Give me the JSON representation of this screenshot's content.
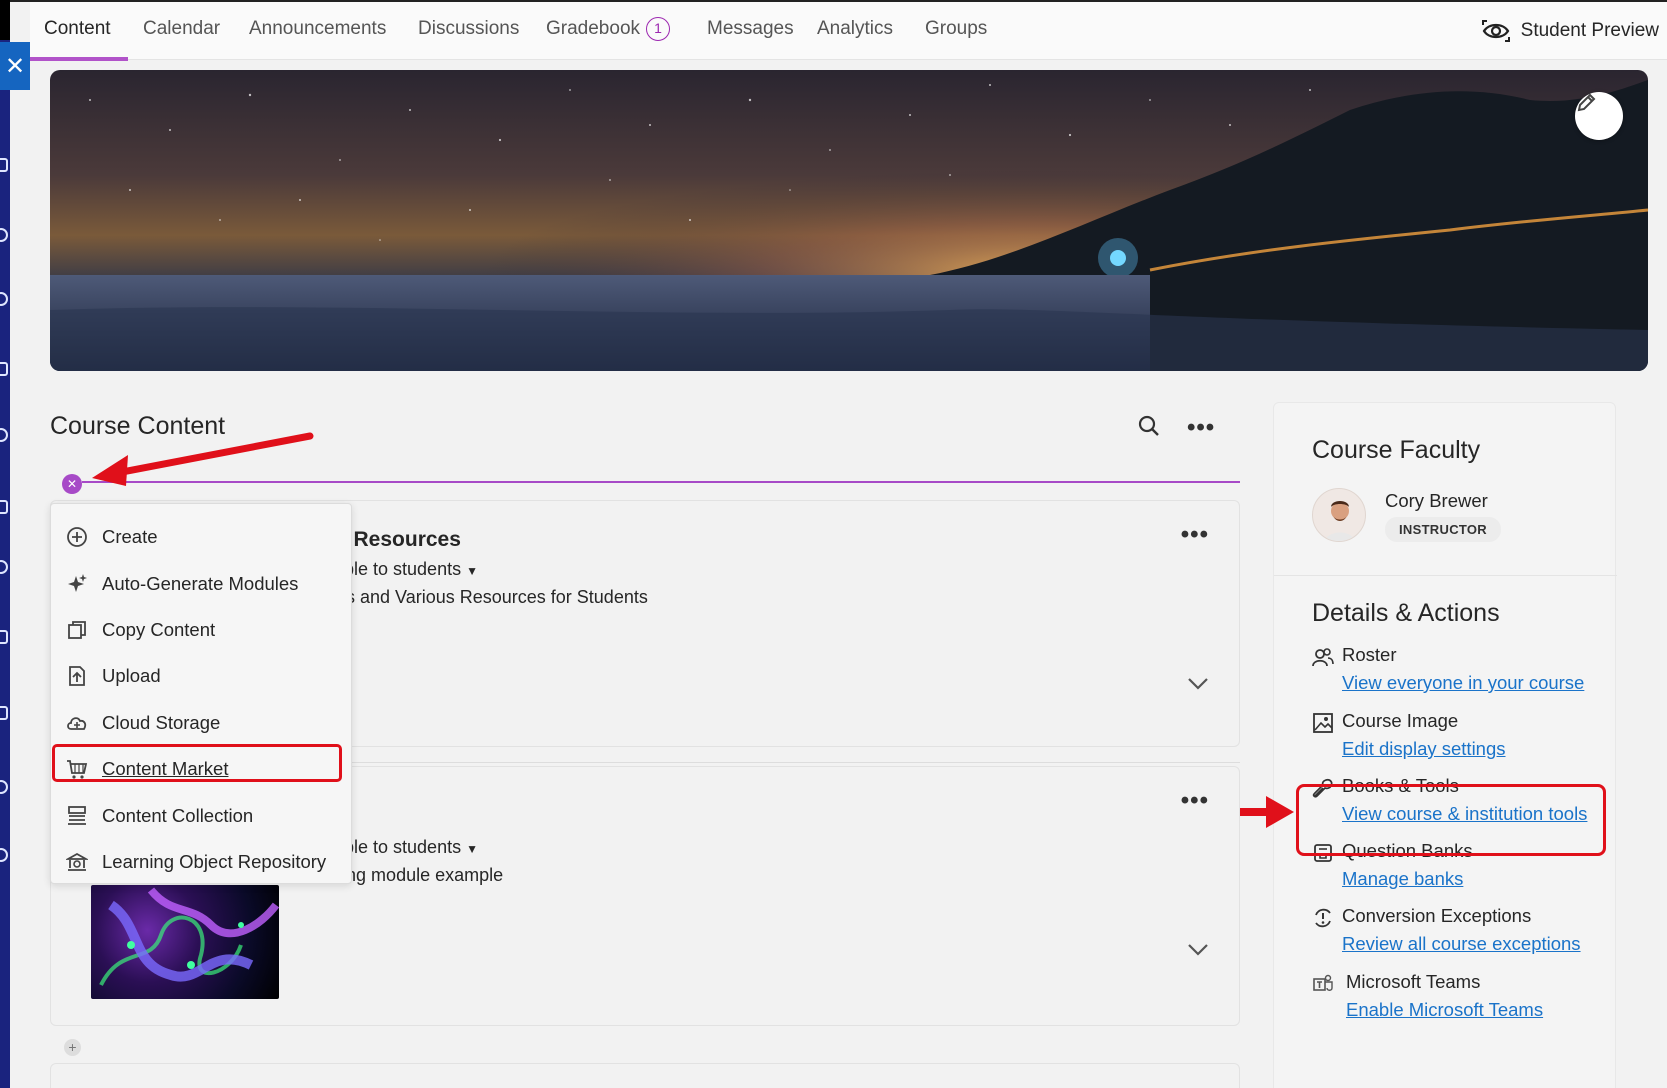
{
  "nav": {
    "tabs": [
      {
        "label": "Content",
        "active": true
      },
      {
        "label": "Calendar"
      },
      {
        "label": "Announcements"
      },
      {
        "label": "Discussions"
      },
      {
        "label": "Gradebook",
        "badge": "1"
      },
      {
        "label": "Messages"
      },
      {
        "label": "Analytics"
      },
      {
        "label": "Groups"
      }
    ],
    "student_preview": "Student Preview"
  },
  "course_content": {
    "title": "Course Content",
    "cards": [
      {
        "title_partial": "e Resources",
        "visibility_partial": "ible to students",
        "description_partial": "us and Various Resources for Students"
      },
      {
        "visibility_partial": "ible to students",
        "description_partial": "Learning module example"
      }
    ]
  },
  "menu": {
    "items": [
      {
        "label": "Create",
        "icon": "plus-circle-icon"
      },
      {
        "label": "Auto-Generate Modules",
        "icon": "sparkle-icon"
      },
      {
        "label": "Copy Content",
        "icon": "copy-icon"
      },
      {
        "label": "Upload",
        "icon": "upload-icon"
      },
      {
        "label": "Cloud Storage",
        "icon": "cloud-icon"
      },
      {
        "label": "Content Market",
        "icon": "cart-icon"
      },
      {
        "label": "Content Collection",
        "icon": "collection-icon"
      },
      {
        "label": "Learning Object Repository",
        "icon": "repository-icon"
      }
    ]
  },
  "sidebar": {
    "faculty_heading": "Course Faculty",
    "faculty_name": "Cory Brewer",
    "faculty_role": "INSTRUCTOR",
    "details_heading": "Details & Actions",
    "items": [
      {
        "label": "Roster",
        "link": "View everyone in your course",
        "icon": "roster-icon"
      },
      {
        "label": "Course Image",
        "link": "Edit display settings",
        "icon": "image-icon"
      },
      {
        "label": "Books & Tools",
        "link": "View course & institution tools",
        "icon": "wrench-icon"
      },
      {
        "label": "Question Banks",
        "link": "Manage banks",
        "icon": "question-bank-icon"
      },
      {
        "label": "Conversion Exceptions",
        "link": "Review all course exceptions",
        "icon": "exception-icon"
      },
      {
        "label": "Microsoft Teams",
        "link": "Enable Microsoft Teams",
        "icon": "teams-icon"
      }
    ]
  },
  "colors": {
    "accent": "#a74ac7",
    "link": "#1a73c9",
    "annotation": "#e0101a"
  }
}
